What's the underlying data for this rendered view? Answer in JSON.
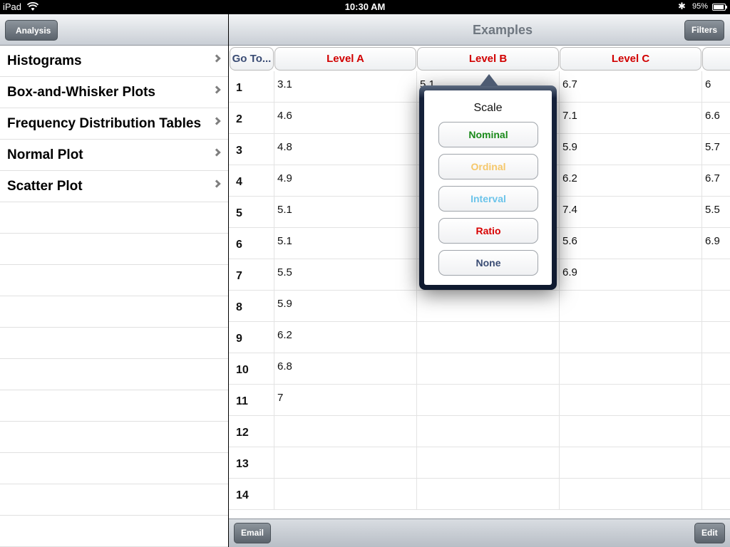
{
  "status": {
    "carrier": "iPad",
    "time": "10:30 AM",
    "battery": "95%",
    "battery_level": 0.95
  },
  "master": {
    "back_label": "Analysis",
    "items": [
      "Histograms",
      "Box-and-Whisker Plots",
      "Frequency Distribution Tables",
      "Normal Plot",
      "Scatter Plot"
    ]
  },
  "detail": {
    "title": "Examples",
    "filters_label": "Filters",
    "columns": [
      "Go To...",
      "Level A",
      "Level B",
      "Level C"
    ],
    "rows": [
      {
        "n": "1",
        "a": "3.1",
        "b": "5.1",
        "c": "6.7",
        "d": "6"
      },
      {
        "n": "2",
        "a": "4.6",
        "b": "",
        "c": "7.1",
        "d": "6.6"
      },
      {
        "n": "3",
        "a": "4.8",
        "b": "",
        "c": "5.9",
        "d": "5.7"
      },
      {
        "n": "4",
        "a": "4.9",
        "b": "",
        "c": "6.2",
        "d": "6.7"
      },
      {
        "n": "5",
        "a": "5.1",
        "b": "",
        "c": "7.4",
        "d": "5.5"
      },
      {
        "n": "6",
        "a": "5.1",
        "b": "",
        "c": "5.6",
        "d": "6.9"
      },
      {
        "n": "7",
        "a": "5.5",
        "b": "",
        "c": "6.9",
        "d": ""
      },
      {
        "n": "8",
        "a": "5.9",
        "b": "",
        "c": "",
        "d": ""
      },
      {
        "n": "9",
        "a": "6.2",
        "b": "",
        "c": "",
        "d": ""
      },
      {
        "n": "10",
        "a": "6.8",
        "b": "",
        "c": "",
        "d": ""
      },
      {
        "n": "11",
        "a": "7",
        "b": "",
        "c": "",
        "d": ""
      },
      {
        "n": "12",
        "a": "",
        "b": "",
        "c": "",
        "d": ""
      },
      {
        "n": "13",
        "a": "",
        "b": "",
        "c": "",
        "d": ""
      },
      {
        "n": "14",
        "a": "",
        "b": "",
        "c": "",
        "d": ""
      }
    ],
    "email_label": "Email",
    "edit_label": "Edit"
  },
  "popover": {
    "title": "Scale",
    "options": [
      {
        "label": "Nominal",
        "color": "#1a8a1a"
      },
      {
        "label": "Ordinal",
        "color": "#f5c76a"
      },
      {
        "label": "Interval",
        "color": "#6cc4ea"
      },
      {
        "label": "Ratio",
        "color": "#d80000"
      },
      {
        "label": "None",
        "color": "#3a4c74"
      }
    ]
  }
}
